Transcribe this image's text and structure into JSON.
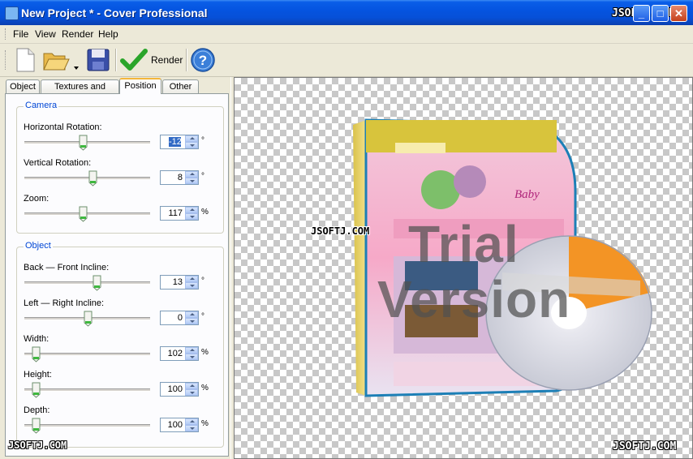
{
  "window": {
    "title": "New Project * - Cover Professional"
  },
  "watermark": "JSOFTJ.COM",
  "menu": [
    "File",
    "View",
    "Render",
    "Help"
  ],
  "toolbar": {
    "render_label": "Render"
  },
  "tabs": [
    "Object",
    "Textures and Colors",
    "Position",
    "Other"
  ],
  "camera": {
    "title": "Camera",
    "horizontal_rotation": {
      "label": "Horizontal Rotation:",
      "value": "-12",
      "unit": "°"
    },
    "vertical_rotation": {
      "label": "Vertical Rotation:",
      "value": "8",
      "unit": "°"
    },
    "zoom": {
      "label": "Zoom:",
      "value": "117",
      "unit": "%"
    }
  },
  "object": {
    "title": "Object",
    "back_front_incline": {
      "label": "Back — Front Incline:",
      "value": "13",
      "unit": "°"
    },
    "left_right_incline": {
      "label": "Left — Right Incline:",
      "value": "0",
      "unit": "°"
    },
    "width": {
      "label": "Width:",
      "value": "102",
      "unit": "%"
    },
    "height": {
      "label": "Height:",
      "value": "100",
      "unit": "%"
    },
    "depth": {
      "label": "Depth:",
      "value": "100",
      "unit": "%"
    }
  },
  "preview": {
    "trial_line1": "Trial",
    "trial_line2": "Version"
  },
  "colors": {
    "titlebar": "#0554e0",
    "accent": "#316ac5",
    "tab_highlight": "#f3b63b"
  }
}
